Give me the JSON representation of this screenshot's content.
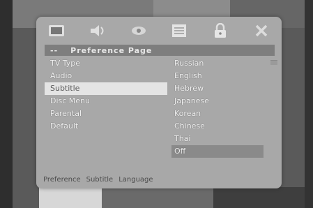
{
  "icons": [
    {
      "name": "general-setup-icon"
    },
    {
      "name": "audio-setup-icon"
    },
    {
      "name": "video-setup-icon"
    },
    {
      "name": "preference-page-icon"
    },
    {
      "name": "password-lock-icon"
    },
    {
      "name": "exit-icon"
    }
  ],
  "header": {
    "prefix": "--",
    "title": "Preference Page"
  },
  "left_items": [
    {
      "label": "TV Type"
    },
    {
      "label": "Audio"
    },
    {
      "label": "Subtitle"
    },
    {
      "label": "Disc Menu"
    },
    {
      "label": "Parental"
    },
    {
      "label": "Default"
    }
  ],
  "right_items": [
    {
      "label": "Russian"
    },
    {
      "label": "English"
    },
    {
      "label": "Hebrew"
    },
    {
      "label": "Japanese"
    },
    {
      "label": "Korean"
    },
    {
      "label": "Chinese"
    },
    {
      "label": "Thai"
    },
    {
      "label": "Off"
    }
  ],
  "status": {
    "path": [
      "Preference",
      "Subtitle",
      "Language"
    ]
  }
}
